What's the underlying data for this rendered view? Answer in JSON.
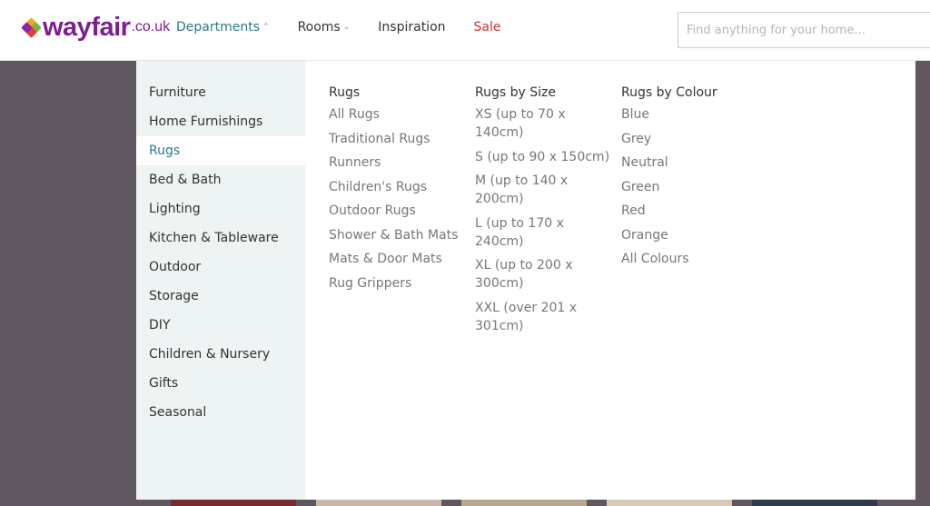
{
  "logo": {
    "text": "wayfair",
    "suffix": ".co.uk"
  },
  "nav": {
    "departments": "Departments",
    "rooms": "Rooms",
    "inspiration": "Inspiration",
    "sale": "Sale"
  },
  "search": {
    "placeholder": "Find anything for your home..."
  },
  "departments": [
    "Furniture",
    "Home Furnishings",
    "Rugs",
    "Bed & Bath",
    "Lighting",
    "Kitchen & Tableware",
    "Outdoor",
    "Storage",
    "DIY",
    "Children & Nursery",
    "Gifts",
    "Seasonal"
  ],
  "selected_department": "Rugs",
  "columns": [
    {
      "heading": "Rugs",
      "links": [
        "All Rugs",
        "Traditional Rugs",
        "Runners",
        "Children's Rugs",
        "Outdoor Rugs",
        "Shower & Bath Mats",
        "Mats & Door Mats",
        "Rug Grippers"
      ]
    },
    {
      "heading": "Rugs by Size",
      "links": [
        "XS (up to 70 x 140cm)",
        "S (up to 90 x 150cm)",
        "M (up to 140 x 200cm)",
        "L (up to 170 x 240cm)",
        "XL (up to 200 x 300cm)",
        "XXL (over 201 x 301cm)"
      ]
    },
    {
      "heading": "Rugs by Colour",
      "links": [
        "Blue",
        "Grey",
        "Neutral",
        "Green",
        "Red",
        "Orange",
        "All Colours"
      ]
    }
  ],
  "colors": {
    "brand": "#7b1f8f",
    "accent": "#2d7a8a",
    "sale": "#d4332b",
    "overlay": "#5f5660"
  },
  "icons": {
    "logo_mark": "wayfair-logo-icon",
    "dropdown_caret": "chevron-down-icon",
    "open_caret": "chevron-up-icon"
  }
}
